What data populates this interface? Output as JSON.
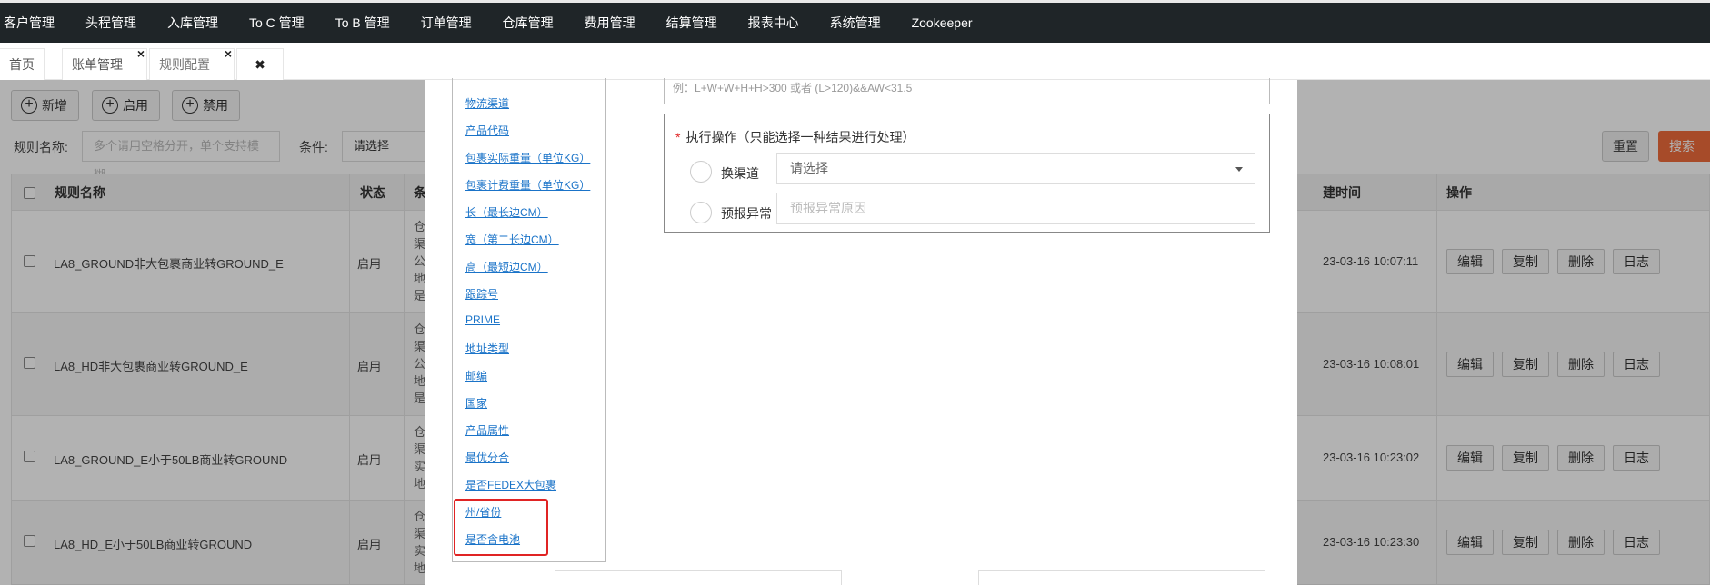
{
  "topnav": [
    "客户管理",
    "头程管理",
    "入库管理",
    "To C 管理",
    "To B 管理",
    "订单管理",
    "仓库管理",
    "费用管理",
    "结算管理",
    "报表中心",
    "系统管理",
    "Zookeeper"
  ],
  "tabs": {
    "home": "首页",
    "bill": "账单管理",
    "rule": "规则配置",
    "close_glyph": "×",
    "close_all_glyph": "✖"
  },
  "toolbar": {
    "add": "新增",
    "enable": "启用",
    "disable": "禁用"
  },
  "filters": {
    "rule_name_label": "规则名称:",
    "rule_name_placeholder": "多个请用空格分开，单个支持模糊",
    "condition_label": "条件:",
    "condition_value": "请选择",
    "reset": "重置",
    "search": "搜索"
  },
  "table": {
    "headers": {
      "name": "规则名称",
      "status": "状态",
      "cond": "条",
      "created": "建时间",
      "ops": "操作"
    },
    "rows": [
      {
        "name": "LA8_GROUND非大包裹商业转GROUND_E",
        "status": "启用",
        "cond": [
          "仓",
          "渠",
          "公",
          "地",
          "是"
        ],
        "created": "23-03-16 10:07:11"
      },
      {
        "name": "LA8_HD非大包裹商业转GROUND_E",
        "status": "启用",
        "cond": [
          "仓",
          "渠",
          "公",
          "地",
          "是"
        ],
        "created": "23-03-16 10:08:01"
      },
      {
        "name": "LA8_GROUND_E小于50LB商业转GROUND",
        "status": "启用",
        "cond": [
          "仓",
          "渠",
          "实",
          "地"
        ],
        "created": "23-03-16 10:23:02"
      },
      {
        "name": "LA8_HD_E小于50LB商业转GROUND",
        "status": "启用",
        "cond": [
          "仓",
          "渠",
          "实",
          "地"
        ],
        "created": "23-03-16 10:23:30"
      }
    ],
    "op_labels": [
      "编辑",
      "复制",
      "删除",
      "日志"
    ]
  },
  "modal": {
    "fields": [
      "物流渠道",
      "产品代码",
      "包裹实际重量（单位KG）",
      "包裹计费重量（单位KG）",
      "长（最长边CM）",
      "宽（第二长边CM）",
      "高（最短边CM）",
      "跟踪号",
      "PRIME",
      "地址类型",
      "邮编",
      "国家",
      "产品属性",
      "最优分合",
      "是否FEDEX大包裹",
      "州/省份",
      "是否含电池"
    ],
    "expr_placeholder": "例：L+W+W+H+H>300 或者 (L>120)&&AW<31.5",
    "action": {
      "star": "*",
      "title": "执行操作（只能选择一种结果进行处理）",
      "switch_channel": "换渠道",
      "channel_select": "请选择",
      "forecast_exception": "预报异常",
      "exception_placeholder": "预报异常原因"
    }
  }
}
